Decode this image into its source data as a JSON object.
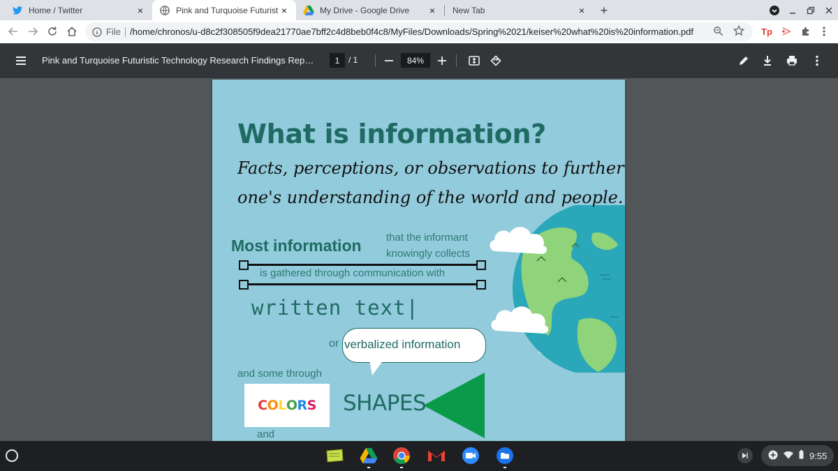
{
  "browser": {
    "tabs": [
      {
        "title": "Home / Twitter",
        "icon": "twitter-icon",
        "active": false
      },
      {
        "title": "Pink and Turquoise Futuristic Te",
        "icon": "globe-icon",
        "active": true
      },
      {
        "title": "My Drive - Google Drive",
        "icon": "google-drive-icon",
        "active": false
      },
      {
        "title": "New Tab",
        "icon": "",
        "active": false
      }
    ],
    "close_glyph": "×",
    "new_tab_glyph": "+",
    "omnibox": {
      "scheme": "File",
      "url": "/home/chronos/u-d8c2f308505f9dea21770ae7bff2c4d8beb0f4c8/MyFiles/Downloads/Spring%2021/keiser%20what%20is%20information.pdf"
    },
    "extension_tp": "Tp"
  },
  "pdf": {
    "title": "Pink and Turquoise Futuristic Technology Research Findings Report I...",
    "page_current": "1",
    "page_total": "/ 1",
    "zoom": "84%"
  },
  "page": {
    "title": "What is information?",
    "subtitle_line1": "Facts, perceptions, or observations to further",
    "subtitle_line2": "one's understanding of the world and people.",
    "most_information": "Most information",
    "informant_line1": "that the informant",
    "informant_line2": "knowingly collects",
    "gathered": "is gathered through communication with",
    "written_text": "written text|",
    "or": "or",
    "verbalized": "verbalized information",
    "some_through": "and some through",
    "colors_letters": [
      "C",
      "O",
      "L",
      "O",
      "R",
      "S"
    ],
    "colors_palette": [
      "#e53935",
      "#fb8c00",
      "#fdd835",
      "#43a047",
      "#1e88e5",
      "#d81b60"
    ],
    "shapes": "SHAPES",
    "and": "and"
  },
  "colors": {
    "page_bg": "#92cbdc",
    "teal_text": "#1f6b63",
    "triangle": "#0a9a4a"
  },
  "shelf": {
    "time": "9:55",
    "apps": [
      "notes-app-icon",
      "google-drive-icon",
      "chrome-icon",
      "gmail-icon",
      "zoom-icon",
      "files-icon"
    ]
  }
}
